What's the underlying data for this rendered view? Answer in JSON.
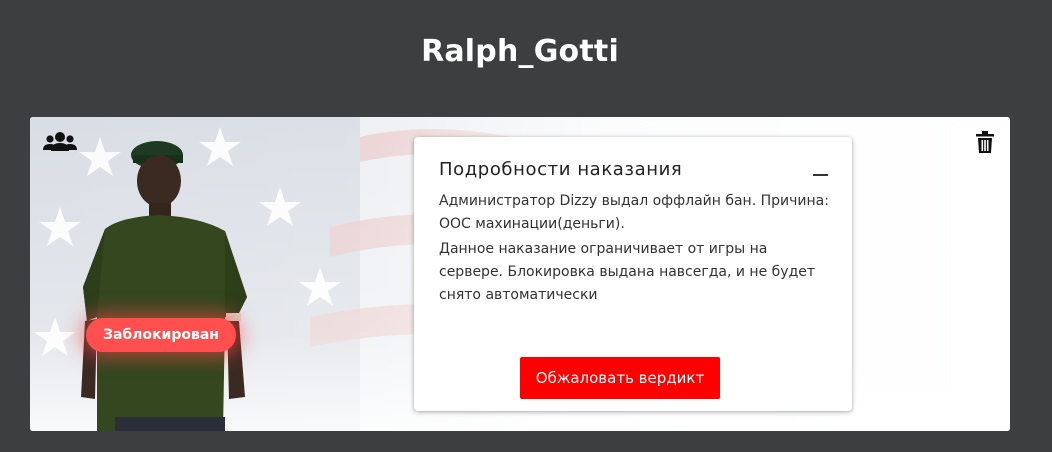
{
  "header": {
    "username": "Ralph_Gotti"
  },
  "card": {
    "icons": {
      "group": "group-icon",
      "delete": "trash-icon"
    },
    "status": {
      "label": "Заблокирован",
      "color": "#ff4f4f"
    },
    "details": {
      "title": "Подробности наказания",
      "collapse_symbol": "—",
      "paragraphs": [
        "Администратор Dizzy выдал оффлайн бан. Причина: ООС махинации(деньги).",
        "Данное наказание ограничивает от игры на сервере. Блокировка выдана навсегда, и не будет снято автоматически"
      ],
      "appeal_label": "Обжаловать вердикт",
      "appeal_color": "#ff0000"
    }
  },
  "colors": {
    "page_bg": "#3d3e40",
    "card_bg": "#ffffff"
  }
}
